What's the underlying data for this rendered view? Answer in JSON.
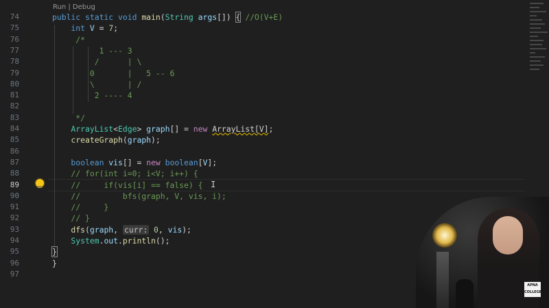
{
  "editor": {
    "codelens": "Run | Debug",
    "active_line": "89",
    "lines": [
      {
        "n": "74",
        "tokens": [
          [
            "kw",
            "public static void "
          ],
          [
            "fn",
            "main"
          ],
          [
            "pn",
            "("
          ],
          [
            "ty",
            "String "
          ],
          [
            "vr",
            "args"
          ],
          [
            "pn",
            "[]) "
          ],
          [
            "bracket",
            "{"
          ],
          [
            "cm",
            " //O(V+E)"
          ]
        ]
      },
      {
        "n": "75",
        "tokens": [
          [
            "kw",
            "    int "
          ],
          [
            "vr",
            "V"
          ],
          [
            "pn",
            " = "
          ],
          [
            "nm",
            "7"
          ],
          [
            "pn",
            ";"
          ]
        ]
      },
      {
        "n": "76",
        "tokens": [
          [
            "cm",
            "     /*"
          ]
        ]
      },
      {
        "n": "77",
        "tokens": [
          [
            "cm",
            "          1 --- 3"
          ]
        ]
      },
      {
        "n": "78",
        "tokens": [
          [
            "cm",
            "         /      | \\"
          ]
        ]
      },
      {
        "n": "79",
        "tokens": [
          [
            "cm",
            "        0       |   5 -- 6"
          ]
        ]
      },
      {
        "n": "80",
        "tokens": [
          [
            "cm",
            "        \\       | /"
          ]
        ]
      },
      {
        "n": "81",
        "tokens": [
          [
            "cm",
            "         2 ---- 4"
          ]
        ]
      },
      {
        "n": "82",
        "tokens": [
          [
            "cm",
            ""
          ]
        ]
      },
      {
        "n": "83",
        "tokens": [
          [
            "cm",
            "     */"
          ]
        ]
      },
      {
        "n": "84",
        "tokens": [
          [
            "ty",
            "    ArrayList"
          ],
          [
            "pn",
            "<"
          ],
          [
            "ty",
            "Edge"
          ],
          [
            "pn",
            "> "
          ],
          [
            "vr",
            "graph"
          ],
          [
            "pn",
            "[] = "
          ],
          [
            "mg",
            "new "
          ],
          [
            "squig",
            "ArrayList[V]"
          ],
          [
            "pn",
            ";"
          ]
        ]
      },
      {
        "n": "85",
        "tokens": [
          [
            "fn",
            "    createGraph"
          ],
          [
            "pn",
            "("
          ],
          [
            "vr",
            "graph"
          ],
          [
            "pn",
            ");"
          ]
        ]
      },
      {
        "n": "86",
        "tokens": [
          [
            "pn",
            ""
          ]
        ]
      },
      {
        "n": "87",
        "tokens": [
          [
            "kw",
            "    boolean "
          ],
          [
            "vr",
            "vis"
          ],
          [
            "pn",
            "[] = "
          ],
          [
            "mg",
            "new "
          ],
          [
            "kw",
            "boolean"
          ],
          [
            "pn",
            "["
          ],
          [
            "vr",
            "V"
          ],
          [
            "pn",
            "];"
          ]
        ]
      },
      {
        "n": "88",
        "tokens": [
          [
            "cm",
            "    // for(int i=0; i<V; i++) {"
          ]
        ]
      },
      {
        "n": "89",
        "tokens": [
          [
            "cm",
            "    //     if(vis[i] == false) {"
          ]
        ]
      },
      {
        "n": "90",
        "tokens": [
          [
            "cm",
            "    //         bfs(graph, V, vis, i);"
          ]
        ]
      },
      {
        "n": "91",
        "tokens": [
          [
            "cm",
            "    //     }"
          ]
        ]
      },
      {
        "n": "92",
        "tokens": [
          [
            "cm",
            "    // }"
          ]
        ]
      },
      {
        "n": "93",
        "tokens": [
          [
            "fn",
            "    dfs"
          ],
          [
            "pn",
            "("
          ],
          [
            "vr",
            "graph"
          ],
          [
            "pn",
            ", "
          ],
          [
            "hint",
            "curr:"
          ],
          [
            "nm",
            " 0"
          ],
          [
            "pn",
            ", "
          ],
          [
            "vr",
            "vis"
          ],
          [
            "pn",
            ");"
          ]
        ]
      },
      {
        "n": "94",
        "tokens": [
          [
            "ty",
            "    System"
          ],
          [
            "pn",
            "."
          ],
          [
            "vr",
            "out"
          ],
          [
            "pn",
            "."
          ],
          [
            "fn",
            "println"
          ],
          [
            "pn",
            "();"
          ]
        ]
      },
      {
        "n": "95",
        "tokens": [
          [
            "bracket",
            "}"
          ]
        ]
      },
      {
        "n": "96",
        "tokens": [
          [
            "pn",
            "}"
          ]
        ]
      },
      {
        "n": "97",
        "tokens": [
          [
            "pn",
            ""
          ]
        ]
      }
    ]
  },
  "video_overlay": {
    "logo_line1": "APNA",
    "logo_line2": "COLLEGE"
  }
}
